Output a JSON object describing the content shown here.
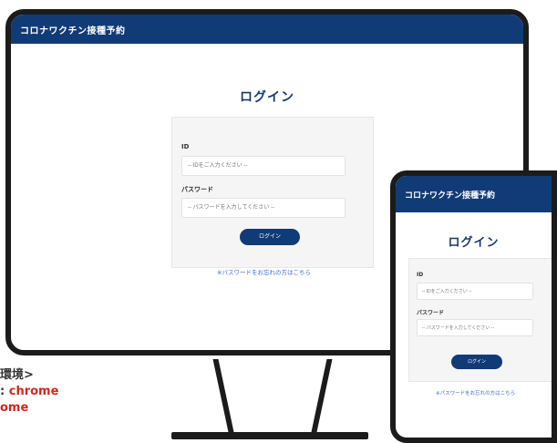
{
  "app": {
    "title": "コロナワクチン接種予約"
  },
  "login": {
    "title": "ログイン",
    "id_label": "ID",
    "id_placeholder": "-- IDをご入力ください --",
    "password_label": "パスワード",
    "password_placeholder": "-- パスワードを入力してください --",
    "button_label": "ログイン",
    "forgot_link": "※パスワードをお忘れの方はこちら"
  },
  "note": {
    "line1": "環境>",
    "line2_prefix": ":",
    "line2_value": "chrome",
    "line3": "ome"
  },
  "colors": {
    "header": "#113b77",
    "button": "#113b77",
    "link": "#3f6ad8",
    "title": "#17396b",
    "note_red": "#d2261d"
  }
}
